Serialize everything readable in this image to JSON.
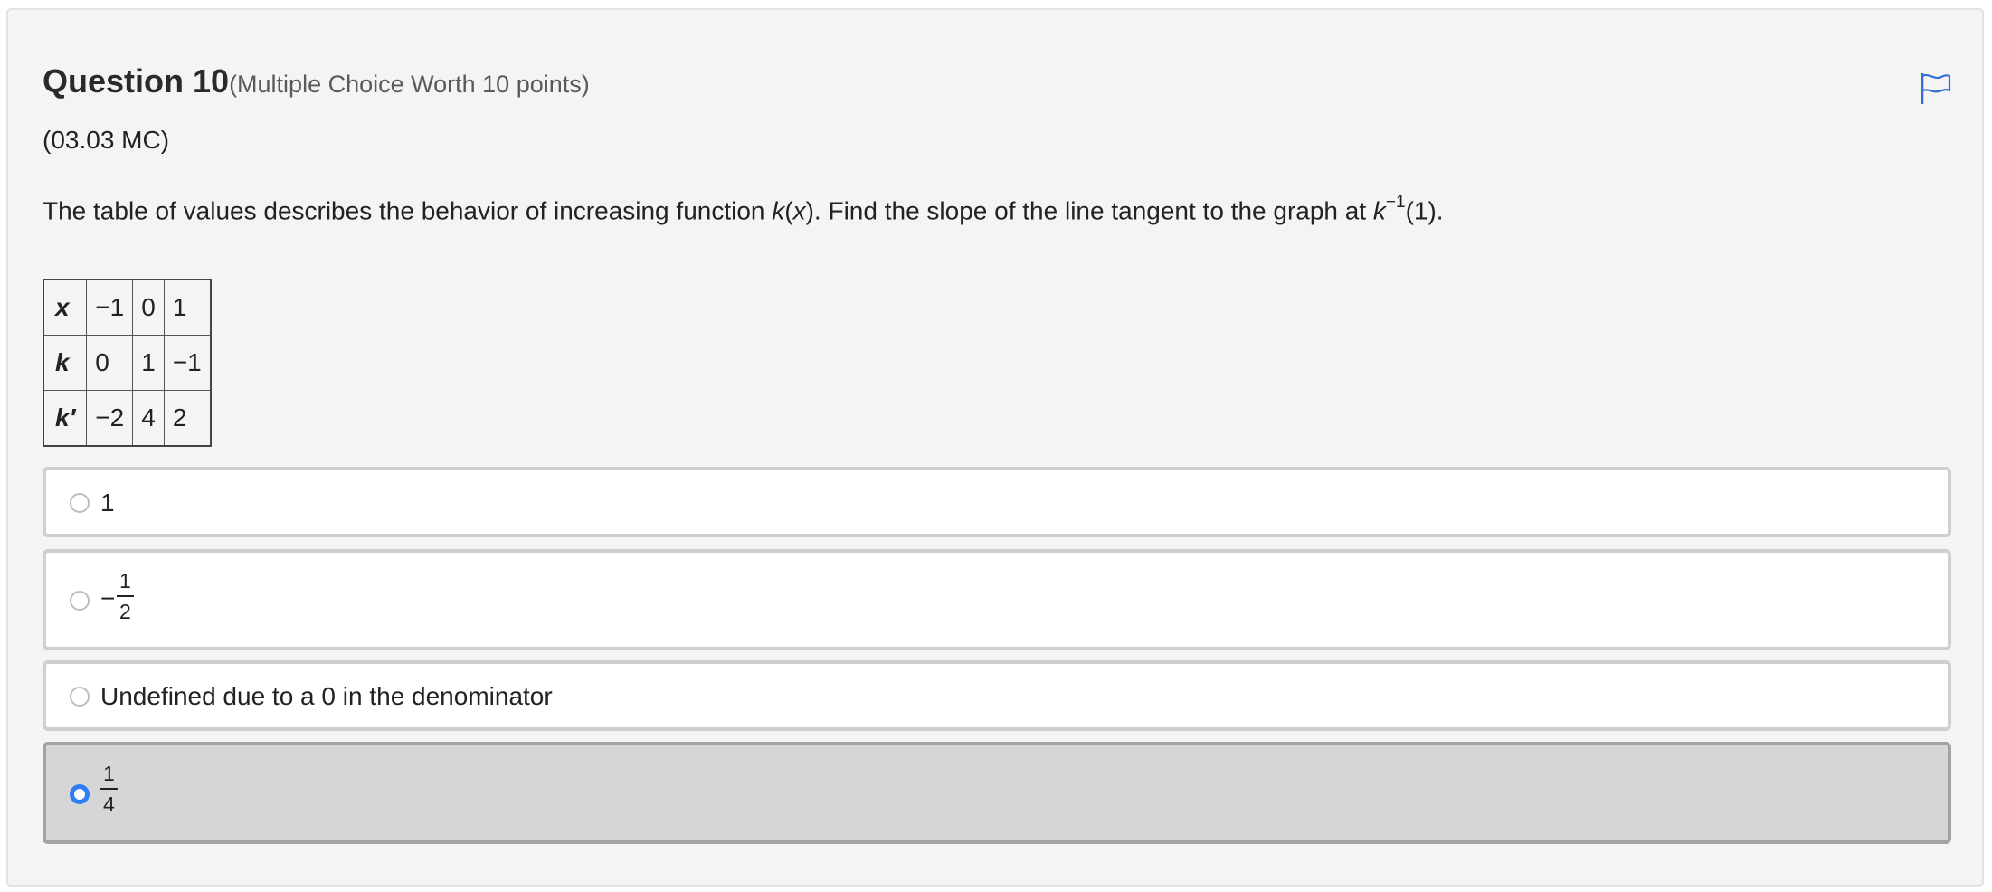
{
  "question": {
    "title": "Question 10",
    "subtitle": "(Multiple Choice Worth 10 points)",
    "code": "(03.03 MC)",
    "prompt": {
      "before": "The table of values describes the behavior of increasing function ",
      "fn_name": "k",
      "fn_open": "(",
      "fn_var": "x",
      "fn_close": ")",
      "middle": ". Find the slope of the line tangent to the graph at ",
      "inv_name": "k",
      "inv_exp": "−1",
      "after": "(1)."
    },
    "flag_icon": "flag-icon"
  },
  "table": {
    "rows": [
      {
        "header": "x",
        "cells": [
          "−1",
          "0",
          "1"
        ]
      },
      {
        "header": "k",
        "cells": [
          "0",
          "1",
          "−1"
        ]
      },
      {
        "header": "k′",
        "cells": [
          "−2",
          "4",
          "2"
        ]
      }
    ]
  },
  "options": [
    {
      "label": "1",
      "selected": false
    },
    {
      "minus": "−",
      "numerator": "1",
      "denominator": "2",
      "selected": false
    },
    {
      "label": "Undefined due to a 0 in the denominator",
      "selected": false
    },
    {
      "numerator": "1",
      "denominator": "4",
      "selected": true
    }
  ],
  "colors": {
    "accent": "#2f7cf6",
    "card_bg": "#f4f4f4",
    "selected_bg": "#d6d6d6"
  }
}
